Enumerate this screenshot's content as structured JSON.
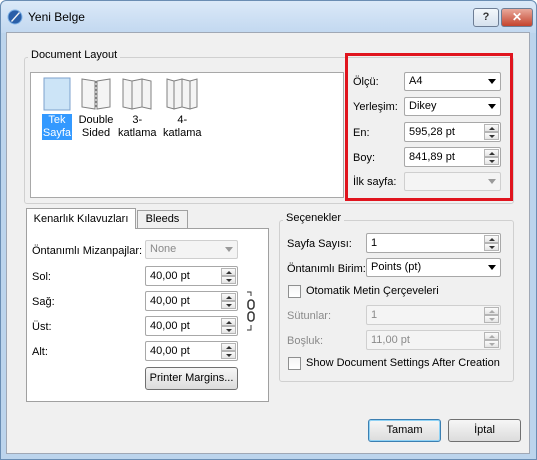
{
  "window": {
    "title": "Yeni Belge",
    "help": "?",
    "close": "✕"
  },
  "document_layout": {
    "group_label": "Document Layout",
    "items": [
      {
        "label_l1": "Tek",
        "label_l2": "Sayfa",
        "selected": true
      },
      {
        "label_l1": "Double",
        "label_l2": "Sided",
        "selected": false
      },
      {
        "label_l1": "3-",
        "label_l2": "katlama",
        "selected": false
      },
      {
        "label_l1": "4-",
        "label_l2": "katlama",
        "selected": false
      }
    ]
  },
  "page": {
    "size_label": "Ölçü:",
    "size_value": "A4",
    "orientation_label": "Yerleşim:",
    "orientation_value": "Dikey",
    "width_label": "En:",
    "width_value": "595,28 pt",
    "height_label": "Boy:",
    "height_value": "841,89 pt",
    "first_page_label": "İlk sayfa:",
    "first_page_value": ""
  },
  "tabs": {
    "margin_guides": "Kenarlık Kılavuzları",
    "bleeds": "Bleeds"
  },
  "margins": {
    "preset_label": "Öntanımlı Mizanpajlar:",
    "preset_value": "None",
    "left_label": "Sol:",
    "left_value": "40,00 pt",
    "right_label": "Sağ:",
    "right_value": "40,00 pt",
    "top_label": "Üst:",
    "top_value": "40,00 pt",
    "bottom_label": "Alt:",
    "bottom_value": "40,00 pt",
    "printer_margins": "Printer Margins..."
  },
  "options": {
    "group_label": "Seçenekler",
    "page_count_label": "Sayfa Sayısı:",
    "page_count_value": "1",
    "unit_label": "Öntanımlı Birim:",
    "unit_value": "Points (pt)",
    "auto_frames_label": "Otomatik Metin Çerçeveleri",
    "columns_label": "Sütunlar:",
    "columns_value": "1",
    "gap_label": "Boşluk:",
    "gap_value": "11,00 pt",
    "show_settings_label": "Show Document Settings After Creation"
  },
  "buttons": {
    "ok": "Tamam",
    "cancel": "İptal"
  },
  "colors": {
    "highlight": "#e0141e",
    "selection": "#3399ff"
  }
}
